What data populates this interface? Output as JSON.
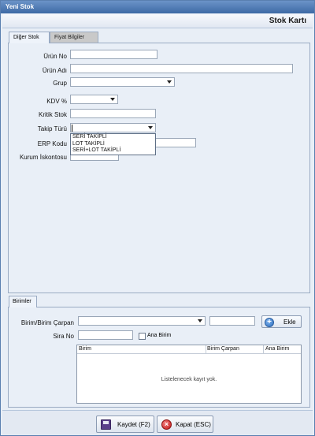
{
  "window": {
    "title": "Yeni Stok",
    "header_title": "Stok Kartı"
  },
  "tabs": [
    {
      "label": "Diğer Stok",
      "active": true
    },
    {
      "label": "Fiyat Bilgiler",
      "active": false
    }
  ],
  "form": {
    "urun_no": {
      "label": "Ürün No",
      "value": ""
    },
    "urun_adi": {
      "label": "Ürün Adı",
      "value": ""
    },
    "grup": {
      "label": "Grup",
      "value": ""
    },
    "kdv": {
      "label": "KDV %",
      "value": ""
    },
    "kritik_stok": {
      "label": "Kritik Stok",
      "value": ""
    },
    "takip_turu": {
      "label": "Takip Türü",
      "value": "",
      "options": [
        "SERİ TAKİPLİ",
        "LOT TAKİPLİ",
        "SERİ+LOT TAKİPLİ"
      ]
    },
    "erp_kodu": {
      "label": "ERP Kodu",
      "value": ""
    },
    "kurum_iskontosu": {
      "label": "Kurum İskontosu",
      "value": ""
    }
  },
  "units": {
    "tab_label": "Birimler",
    "birim_carpan_label": "Birim/Birim Çarpan",
    "sira_no_label": "Sira No",
    "ana_birim_label": "Ana Birim",
    "ana_birim_checked": false,
    "add_button_label": "Ekle",
    "columns": [
      "Birim",
      "Birim Çarpan",
      "Ana Birim"
    ],
    "rows": [],
    "empty_text": "Listelenecek kayıt yok."
  },
  "footer": {
    "save_label": "Kaydet (F2)",
    "close_label": "Kapat (ESC)"
  },
  "icons": {
    "add": "plus-circle-icon",
    "save": "floppy-disk-icon",
    "close": "close-circle-icon"
  },
  "colors": {
    "titlebar": "#3e6aa5",
    "panel": "#e9eff7",
    "close_red": "#c21818",
    "add_blue": "#2e6fbf"
  }
}
